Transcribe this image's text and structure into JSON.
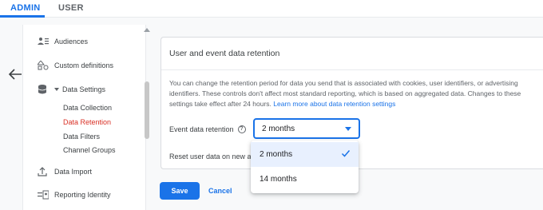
{
  "tabs": {
    "admin": "ADMIN",
    "user": "USER"
  },
  "sidebar": {
    "items": [
      {
        "label": "Audiences"
      },
      {
        "label": "Custom definitions"
      },
      {
        "label": "Data Settings"
      },
      {
        "label": "Data Import"
      },
      {
        "label": "Reporting Identity"
      }
    ],
    "sub_items": [
      {
        "label": "Data Collection"
      },
      {
        "label": "Data Retention"
      },
      {
        "label": "Data Filters"
      },
      {
        "label": "Channel Groups"
      }
    ]
  },
  "main": {
    "title": "User and event data retention",
    "description_lines": [
      "You can change the retention period for data you send that is associated with cookies, user identifiers, or advertising",
      "identifiers. These controls don't affect most standard reporting, which is based on aggregated data. Changes to these",
      "settings take effect after 24 hours. "
    ],
    "learn_more": "Learn more about data retention settings",
    "field_label": "Event data retention",
    "selected_value": "2 months",
    "options": [
      "2 months",
      "14 months"
    ],
    "reset_label": "Reset user data on new activity"
  },
  "actions": {
    "save": "Save",
    "cancel": "Cancel"
  },
  "colors": {
    "accent": "#1a73e8",
    "active_sub_item": "#d93025"
  }
}
